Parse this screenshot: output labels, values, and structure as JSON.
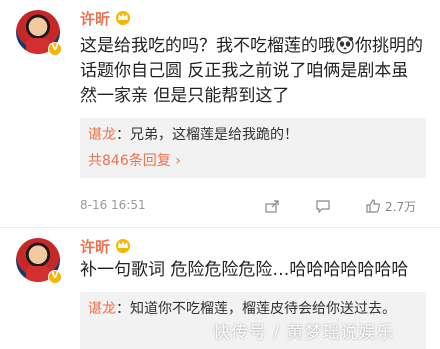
{
  "comments": [
    {
      "username": "许昕",
      "text_part1": "这是给我吃的吗？我不吃榴莲的哦",
      "text_part2": "你挑明的话题你自己圆 反正我之前说了咱俩是剧本虽然一家亲 但是只能帮到这了",
      "reply_author": "谌龙",
      "reply_text": "：兄弟，这榴莲是给我跪的！",
      "more_replies": "共846条回复",
      "more_replies_arrow": "›",
      "time": "8-16 16:51",
      "like_count": "2.7万",
      "icons": [
        "vip-crown-icon",
        "verified-v-icon",
        "panda-emoji-icon",
        "share-icon",
        "comment-icon",
        "like-icon"
      ]
    },
    {
      "username": "许昕",
      "text": "补一句歌词 危险危险危险…哈哈哈哈哈哈哈",
      "reply_author": "谌龙",
      "reply_text": "：知道你不吃榴莲，榴莲皮待会给你送过去。",
      "icons": [
        "vip-crown-icon",
        "verified-v-icon"
      ]
    }
  ],
  "watermark": "快传号 / 黄梦瑶说娱乐",
  "colors": {
    "accent": "#eb7350",
    "vip": "#f7b500",
    "reply_bg": "#f2f2f2"
  }
}
